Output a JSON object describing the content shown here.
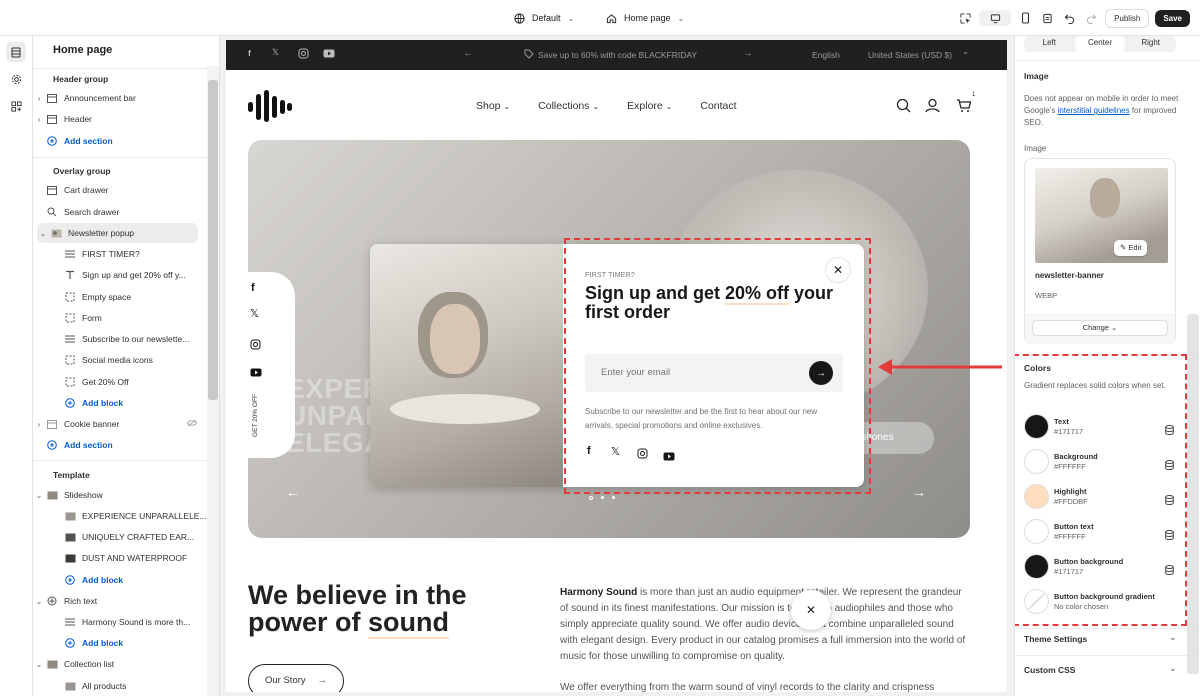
{
  "topbar": {
    "theme": "Default",
    "page": "Home page",
    "publish": "Publish",
    "save": "Save"
  },
  "sidebar": {
    "title": "Home page",
    "groups": [
      {
        "label": "Header group",
        "items": [
          "Announcement bar",
          "Header"
        ],
        "add": "Add section"
      },
      {
        "label": "Overlay group",
        "items": [
          "Cart drawer",
          "Search drawer"
        ],
        "selected": "Newsletter popup",
        "blocks": [
          "FIRST TIMER?",
          "Sign up and get 20% off y...",
          "Empty space",
          "Form",
          "Subscribe to our newslette...",
          "Social media icons",
          "Get 20% Off"
        ],
        "add_block": "Add block",
        "cookie": "Cookie banner",
        "add": "Add section"
      },
      {
        "label": "Template",
        "slideshow": "Slideshow",
        "slides": [
          "EXPERIENCE UNPARALLELE...",
          "UNIQUELY CRAFTED EAR...",
          "DUST AND WATERPROOF"
        ],
        "add_block": "Add block",
        "rich_text": "Rich text",
        "rich_blocks": [
          "Harmony Sound is more th..."
        ],
        "add_block2": "Add block",
        "collection_list": "Collection list",
        "collection_blocks": [
          "All products"
        ]
      }
    ]
  },
  "preview": {
    "announcement": {
      "text": "Save up to 60% with code BLACKFRIDAY",
      "language": "English",
      "currency": "United States (USD $)"
    },
    "nav": [
      "Shop",
      "Collections",
      "Explore",
      "Contact"
    ],
    "cart_count": "1",
    "hero_lines": [
      "EXPER",
      "UNPAR",
      "ELEGA"
    ],
    "hero_side": "GET 20% OFF",
    "hero_button": "eadphones",
    "popup": {
      "eyebrow": "FIRST TIMER?",
      "headline_before": "Sign up and get ",
      "headline_highlight": "20% off",
      "headline_after": " your first order",
      "email_placeholder": "Enter your email",
      "body": "Subscribe to our newsletter and be the first to hear about our new arrivals, special promotions and online exclusives."
    },
    "about": {
      "heading_l1": "We believe in the",
      "heading_l2a": "power of ",
      "heading_l2b": "sound",
      "cta": "Our Story",
      "brand": "Harmony Sound",
      "p1": " is more than just an audio equipment retailer. We represent the grandeur of sound in its finest manifestations. Our mission is to cater to audiophiles and those who simply appreciate quality sound. We offer audio devices that combine unparalleled sound with elegant design. Every product in our catalog promises a full immersion into the world of music for those unwilling to compromise on quality.",
      "p2": "We offer everything from the warm sound of vinyl records to the clarity and crispness"
    }
  },
  "right_panel": {
    "align": [
      "Left",
      "Center",
      "Right"
    ],
    "image_title": "Image",
    "image_desc_before": "Does not appear on mobile in order to meet Google's ",
    "image_desc_link": "interstitial guidelines",
    "image_desc_after": " for improved SEO.",
    "image_label": "Image",
    "image_edit": "Edit",
    "image_name": "newsletter-banner",
    "image_type": "WEBP",
    "change": "Change",
    "colors_title": "Colors",
    "colors_desc": "Gradient replaces solid colors when set.",
    "colors": [
      {
        "name": "Text",
        "value": "#171717",
        "hex": "#171717"
      },
      {
        "name": "Background",
        "value": "#FFFFFF",
        "hex": "#FFFFFF"
      },
      {
        "name": "Highlight",
        "value": "#FFDDBF",
        "hex": "#FFDDBF"
      },
      {
        "name": "Button text",
        "value": "#FFFFFF",
        "hex": "#FFFFFF"
      },
      {
        "name": "Button background",
        "value": "#171717",
        "hex": "#171717"
      },
      {
        "name": "Button background gradient",
        "value": "No color chosen",
        "hex": ""
      }
    ],
    "theme_settings": "Theme Settings",
    "custom_css": "Custom CSS"
  }
}
